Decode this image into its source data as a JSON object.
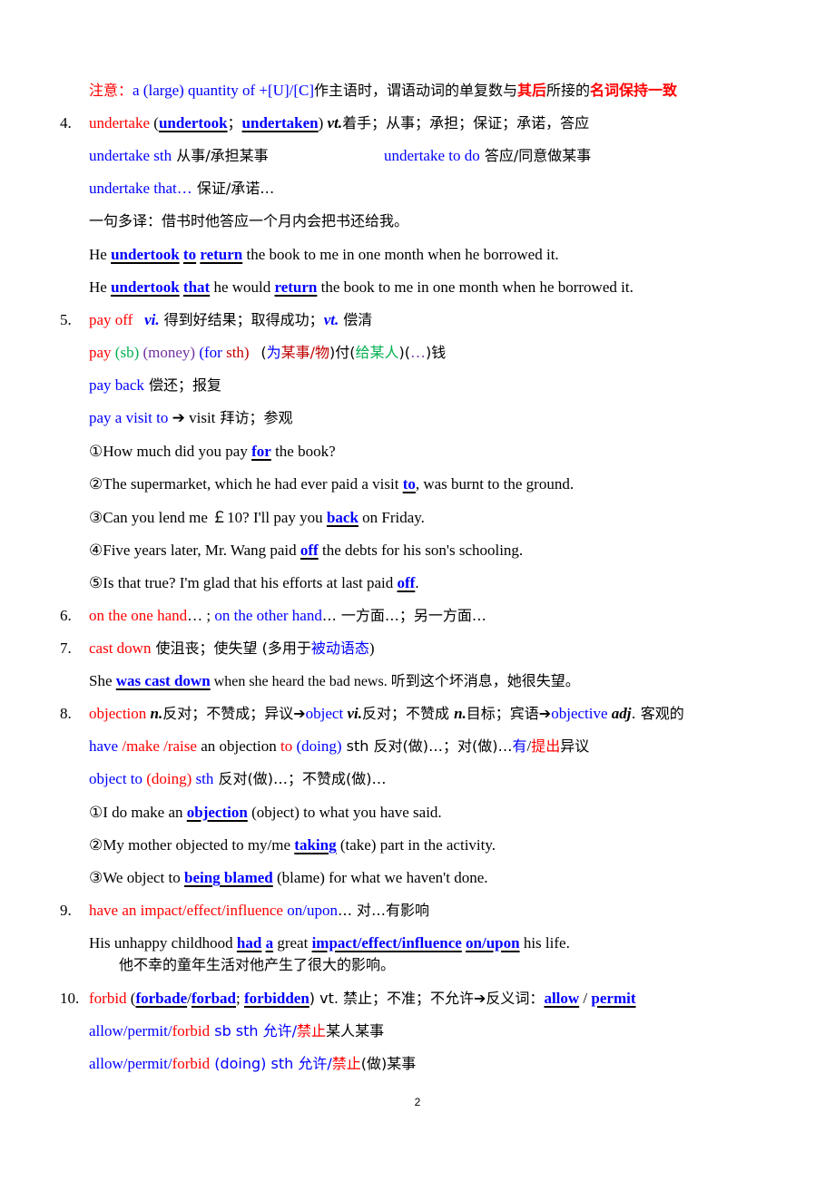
{
  "note": {
    "label": "注意：",
    "phrase": "a (large) quantity of +[U]/[C]",
    "text1": "作主语时，谓语动词的单复数与",
    "emph1": "其后",
    "text2": "所接的",
    "emph2": "名词保持一致"
  },
  "items": {
    "i4": {
      "num": "4.",
      "head": "undertake",
      "p1": " (",
      "f1": "undertook",
      "sep": "；",
      "f2": "undertaken",
      "p2": ") ",
      "pos": "vt.",
      "meaning": "着手；从事；承担；保证；承诺，答应",
      "u1_en": "undertake sth",
      "u1_cn": " 从事/承担某事",
      "u2_en": "undertake to do",
      "u2_cn": " 答应/同意做某事",
      "u3_en": "undertake that…",
      "u3_cn": " 保证/承诺…",
      "multi": "一句多译：借书时他答应一个月内会把书还给我。",
      "ex1": {
        "a": "He ",
        "b": "undertook",
        "c": " ",
        "d": "to",
        "e": " ",
        "f": "return",
        "g": " the book to me in one month when he borrowed it."
      },
      "ex2": {
        "a": "He ",
        "b": "undertook",
        "c": " ",
        "d": "that",
        "e": " he would ",
        "f": "return",
        "g": " the book to me in one month when he borrowed it."
      }
    },
    "i5": {
      "num": "5.",
      "head": "pay off",
      "pos1": "vi.",
      "m1": " 得到好结果；取得成功；",
      "pos2": "vt.",
      "m2": " 偿清",
      "pat": {
        "pay": "pay",
        "sb": "(sb)",
        "money": "(money)",
        "for_open": "(for",
        "sth": "sth)",
        "cn_open": "(",
        "cn_for": "为",
        "cn_thing": "某事/物",
        "cn_close": ")付(",
        "cn_person": "给某人",
        "cn_mid": ")(",
        "cn_dots": "…",
        "cn_end": ")钱"
      },
      "back_en": "pay back",
      "back_cn": " 偿还；报复",
      "visit_en": "pay a visit to",
      "visit_arrow": " ➔ visit",
      "visit_cn": " 拜访；参观",
      "examples": [
        {
          "pre": "①How much did you pay ",
          "ans": "for",
          "post": " the book?"
        },
        {
          "pre": "②The supermarket, which he had ever paid a visit ",
          "ans": "to",
          "post": ", was burnt to the ground."
        },
        {
          "pre": "③Can you lend me  ￡10? I'll pay you ",
          "ans": "back",
          "post": " on Friday."
        },
        {
          "pre": "④Five years later, Mr. Wang paid ",
          "ans": "off",
          "post": " the debts for his son's schooling."
        },
        {
          "pre": "⑤Is that true? I'm glad that his efforts at last paid ",
          "ans": "off",
          "post": "."
        }
      ]
    },
    "i6": {
      "num": "6.",
      "a": "on the one hand",
      "b": "… ; ",
      "c": "on the other hand",
      "d": "…  一方面…；另一方面…"
    },
    "i7": {
      "num": "7.",
      "head": "cast down",
      "m1": "  使沮丧；使失望  (多用于",
      "m2": "被动语态",
      "m3": ")",
      "ex_a": "She ",
      "ex_ans": "was cast down",
      "ex_b": " when she heard the bad news.  听到这个坏消息，她很失望。"
    },
    "i8": {
      "num": "8.",
      "head": "objection",
      "pos1": "n.",
      "m1": "反对；不赞成；异议➔",
      "w2": "object",
      "pos2": "vi.",
      "m2": "反对；不赞成  ",
      "pos3": "n.",
      "m3": "目标；宾语➔",
      "w3": "objective",
      "pos4": "adj",
      "m4": ".  客观的",
      "u1": {
        "have": "have ",
        "make": "/make /raise",
        "an": " an objection ",
        "to": "to",
        "doing": " (doing)",
        "sth": " sth  反对(做)…；对(做)…",
        "you": "有",
        "slash": "/",
        "tichu": "提出",
        "end": "异议"
      },
      "u2": {
        "a": "object to ",
        "b": "(doing)",
        "c": " sth",
        "d": " 反对(做)…；不赞成(做)…"
      },
      "examples": [
        {
          "pre": "①I do make an ",
          "ans": "objection",
          "post": " (object) to what you have said."
        },
        {
          "pre": "②My mother objected to my/me ",
          "ans": "taking",
          "post": " (take) part in the activity."
        },
        {
          "pre": "③We object to ",
          "ans": "being blamed",
          "post": " (blame) for what we haven't done."
        }
      ]
    },
    "i9": {
      "num": "9.",
      "head": "have an impact/effect/influence",
      "on": " on/upon",
      "m": "…  对…有影响",
      "ex_a": "His unhappy childhood ",
      "ex_had": "had",
      "ex_sp": " ",
      "ex_a2": "a",
      "ex_great": " great ",
      "ex_ans": "impact/effect/influence",
      "ex_sp2": " ",
      "ex_on": "on/upon",
      "ex_end": " his life.",
      "ex_cn": "他不幸的童年生活对他产生了很大的影响。"
    },
    "i10": {
      "num": "10.",
      "head": "forbid",
      "p1": " (",
      "f1": "forbade",
      "s1": "/",
      "f2": "forbad",
      "s2": "; ",
      "f3": "forbidden",
      "p2": ") vt.  禁止；不准；不允许➔反义词：",
      "a1": "allow",
      "s3": " / ",
      "a2": "permit",
      "u1": {
        "a": "allow/permit/",
        "b": "forbid",
        "c": " sb sth  允许/",
        "d": "禁止",
        "e": "某人某事"
      },
      "u2": {
        "a": "allow/permit/",
        "b": "forbid",
        "c": " (doing) sth 允许/",
        "d": "禁止",
        "e": "(做)某事"
      }
    }
  },
  "page_number": "2"
}
